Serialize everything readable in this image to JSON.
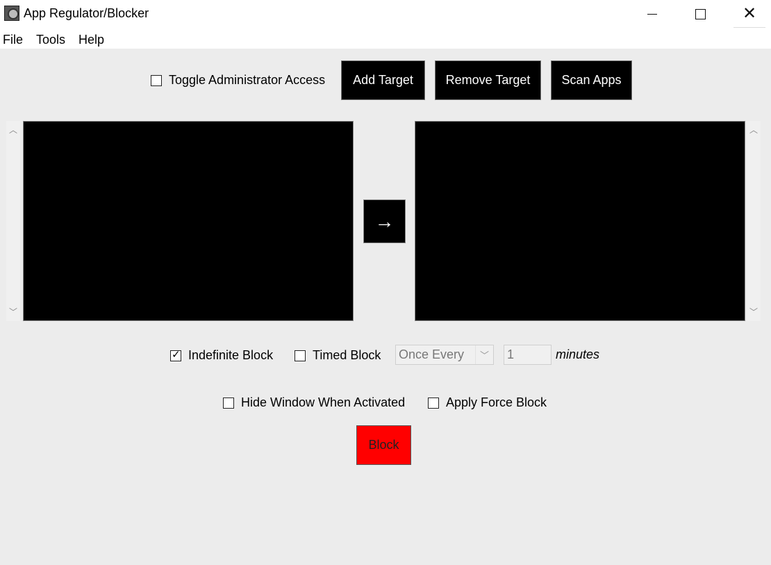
{
  "window": {
    "title": "App Regulator/Blocker",
    "icon": "app-icon",
    "controls": [
      "minimize-icon",
      "maximize-icon",
      "close-icon"
    ]
  },
  "menu": {
    "file": "File",
    "tools": "Tools",
    "help": "Help"
  },
  "toolbar": {
    "admin_toggle_label": "Toggle Administrator Access",
    "admin_toggle_checked": false,
    "add_target": "Add Target",
    "remove_target": "Remove Target",
    "scan_apps": "Scan Apps"
  },
  "lists": {
    "source_items": [],
    "target_items": [],
    "transfer_symbol": "→"
  },
  "options": {
    "indefinite_block_label": "Indefinite Block",
    "indefinite_block_checked": true,
    "timed_block_label": "Timed Block",
    "timed_block_checked": false,
    "interval_select_value": "Once Every",
    "interval_value": "1",
    "interval_unit": "minutes",
    "hide_window_label": "Hide Window When Activated",
    "hide_window_checked": false,
    "force_block_label": "Apply Force Block",
    "force_block_checked": false
  },
  "actions": {
    "block_label": "Block",
    "block_color": "#ff0000"
  }
}
